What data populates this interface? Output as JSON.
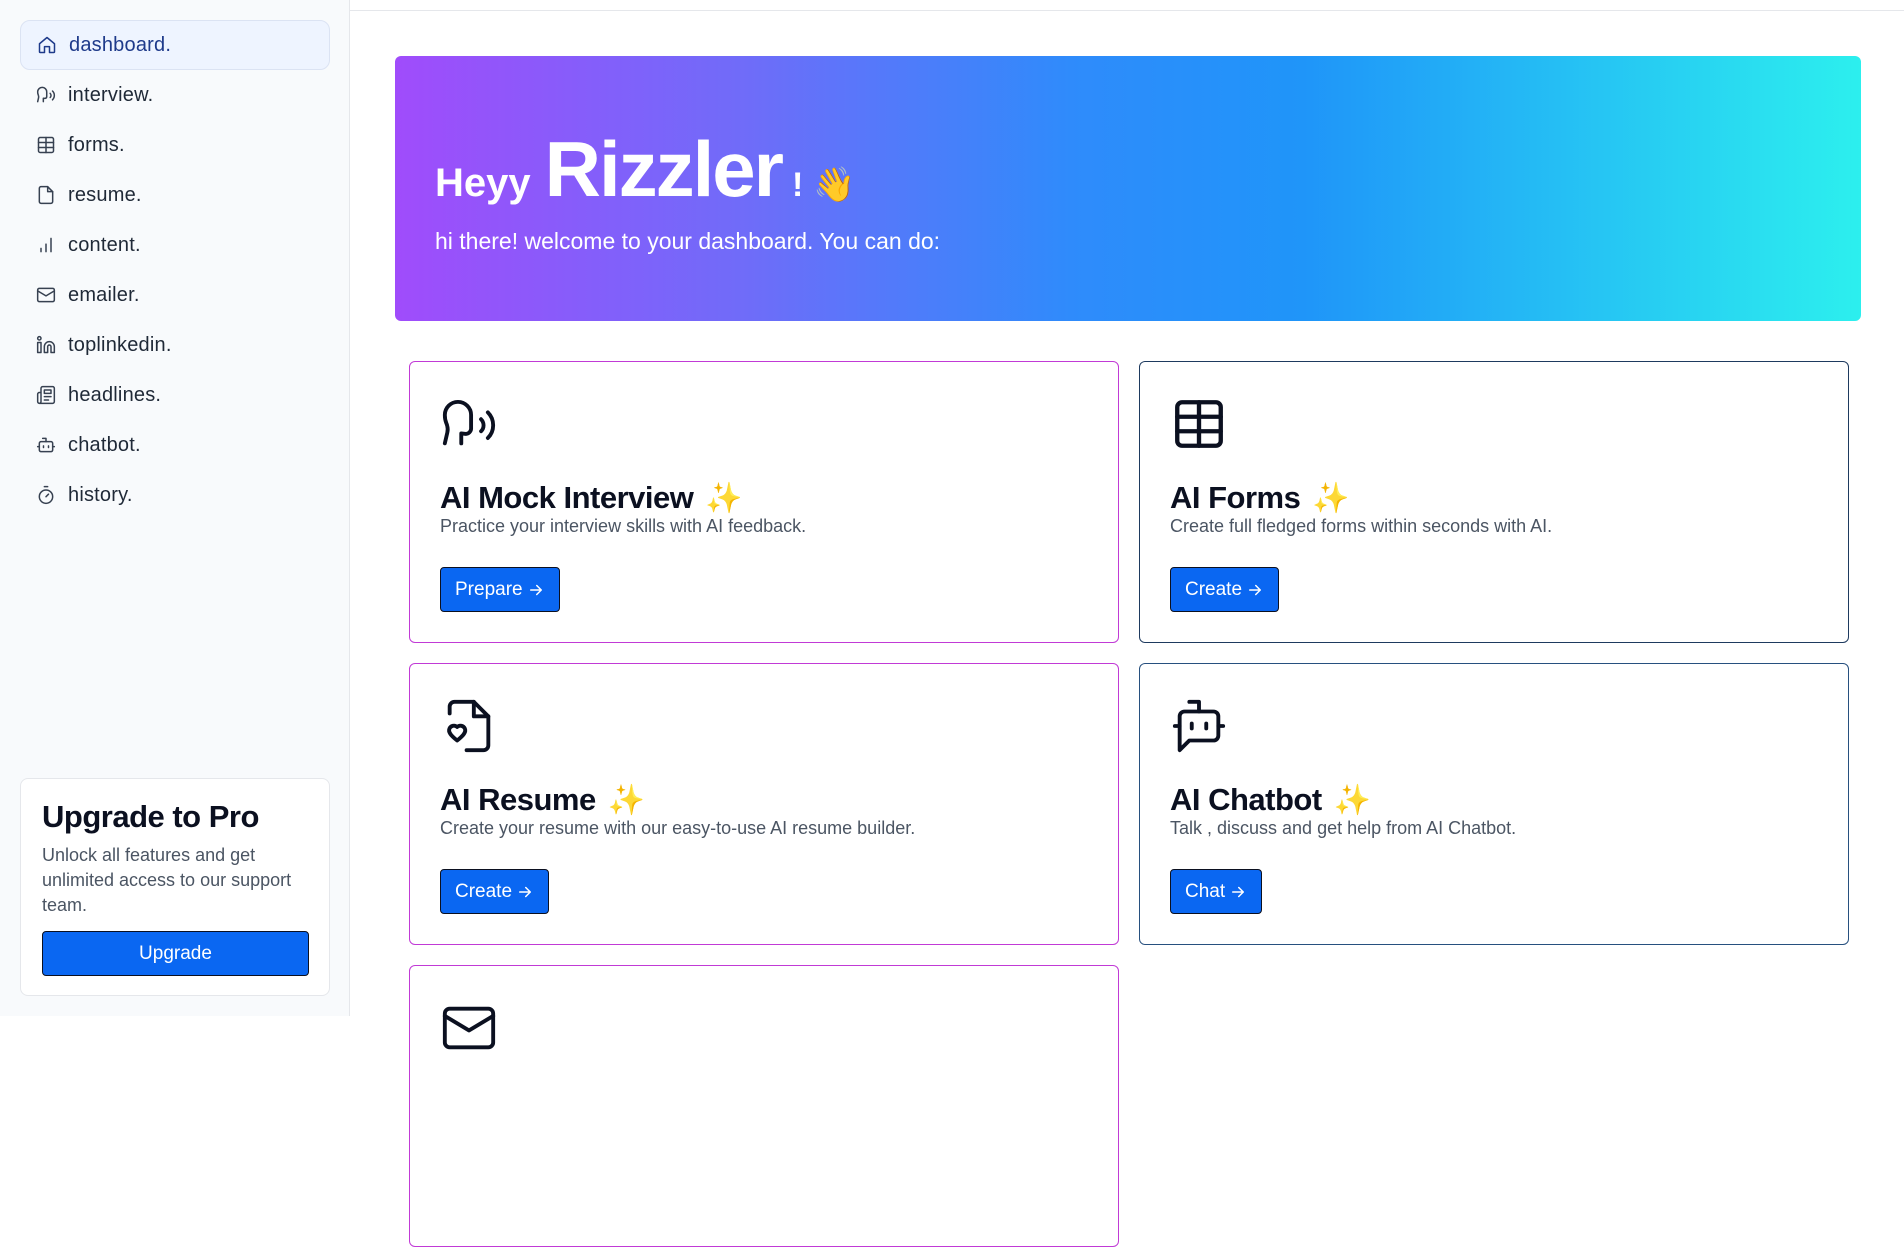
{
  "sidebar": {
    "items": [
      {
        "label": "dashboard.",
        "icon": "home-icon"
      },
      {
        "label": "interview.",
        "icon": "speech-icon"
      },
      {
        "label": "forms.",
        "icon": "table-icon"
      },
      {
        "label": "resume.",
        "icon": "file-icon"
      },
      {
        "label": "content.",
        "icon": "bar-chart-icon"
      },
      {
        "label": "emailer.",
        "icon": "mail-icon"
      },
      {
        "label": "toplinkedin.",
        "icon": "linkedin-icon"
      },
      {
        "label": "headlines.",
        "icon": "newspaper-icon"
      },
      {
        "label": "chatbot.",
        "icon": "bot-icon"
      },
      {
        "label": "history.",
        "icon": "timer-icon"
      }
    ],
    "active_index": 0
  },
  "upgrade": {
    "title": "Upgrade to Pro",
    "description": "Unlock all features and get unlimited access to our support team.",
    "button_label": "Upgrade"
  },
  "hero": {
    "greeting": "Heyy",
    "name": "Rizzler",
    "exclamation": "!",
    "wave": "👋",
    "subtitle": "hi there! welcome to your dashboard. You can do:"
  },
  "cards": [
    {
      "title": "AI Mock Interview",
      "description": "Practice your interview skills with AI feedback.",
      "button": "Prepare",
      "icon": "speech-icon"
    },
    {
      "title": "AI Forms",
      "description": "Create full fledged forms within seconds with AI.",
      "button": "Create",
      "icon": "table-icon"
    },
    {
      "title": "AI Resume",
      "description": "Create your resume with our easy-to-use AI resume builder.",
      "button": "Create",
      "icon": "file-heart-icon"
    },
    {
      "title": "AI Chatbot",
      "description": "Talk , discuss and get help from AI Chatbot.",
      "button": "Chat",
      "icon": "bot-icon"
    }
  ],
  "sparkle": "✨",
  "colors": {
    "primary_button": "#0a67f2",
    "gradient_start": "#a04cfb",
    "gradient_end": "#2cefee",
    "card_border_purple": "#c13ad6"
  }
}
